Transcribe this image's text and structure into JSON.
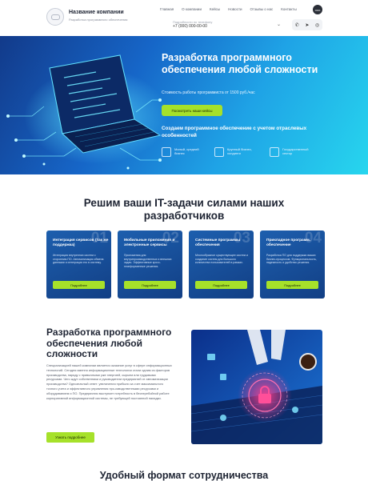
{
  "header": {
    "company_name": "Название компании",
    "company_sub": "Разработка программного обеспечения",
    "nav": [
      "Главная",
      "О компании",
      "Кейсы",
      "Новости",
      "Отзывы о нас",
      "Контакты"
    ],
    "phone_label": "Подробности по телефону",
    "phone": "+7 (000) 000-00-00",
    "eye_label": "ooo"
  },
  "hero": {
    "title": "Разработка программного обеспечения любой сложности",
    "subtitle": "Стоимость работы программиста от 1500 руб./час",
    "button": "Посмотреть наши кейсы",
    "tagline": "Создаем программное обеспечение с учетом отраслевых особенностей",
    "features": [
      "Малый, средний бизнес",
      "Крупный бизнес, холдинги",
      "Государственный сектор"
    ]
  },
  "section1": {
    "title": "Решим ваши IT-задачи силами наших разработчиков",
    "cards": [
      {
        "num": "01",
        "title": "Интеграция сервисов (так же поддержка)",
        "text": "Интеграция внутренних систем с сторонним ПО. Автоматизация обмена данными и интеграция его в систему.",
        "button": "Подробнее"
      },
      {
        "num": "02",
        "title": "Мобильные приложения и электронные сервисы",
        "text": "Приложения для внутрипроизводственных и внешних задач. Эффективные кросс-платформенные решения.",
        "button": "Подробнее"
      },
      {
        "num": "03",
        "title": "Системные программы обеспечения",
        "text": "Многообразное существующее систем и создание систем для большого количества пользователей в рамках.",
        "button": "Подробнее"
      },
      {
        "num": "04",
        "title": "Прикладное программ. обеспечение",
        "text": "Разработка ПО для поддержки ваших бизнес-процессов. Функциональность, надежность и удобство решения.",
        "button": "Подробнее"
      }
    ]
  },
  "section2": {
    "title": "Разработка программного обеспечения любой сложности",
    "text": "Специализацией нашей компании является оказание услуг в сфере информационных технологий. Сегодня именно информационные технологии стали одним из факторов производства, наряду с привычными уже энергией, сырьем или трудовыми ресурсами. Чего ждут собственники и руководители предприятий от автоматизации производства? Однозначный ответ: увеличения прибыли за счет максимального точного учета и эффективного управления про-изводственными ресурсами и оборудованием и ПО. Предприятия выступает потребность в бесперебойной работе корпоративной информационной системы, не требующей постоянной наладки.",
    "button": "Узнать подробнее"
  },
  "section3": {
    "title": "Удобный формат сотрудничества"
  },
  "colors": {
    "accent": "#a6e12a",
    "card_blue": "#1d5fae",
    "hero_start": "#123a8a",
    "hero_end": "#27d6ee"
  }
}
